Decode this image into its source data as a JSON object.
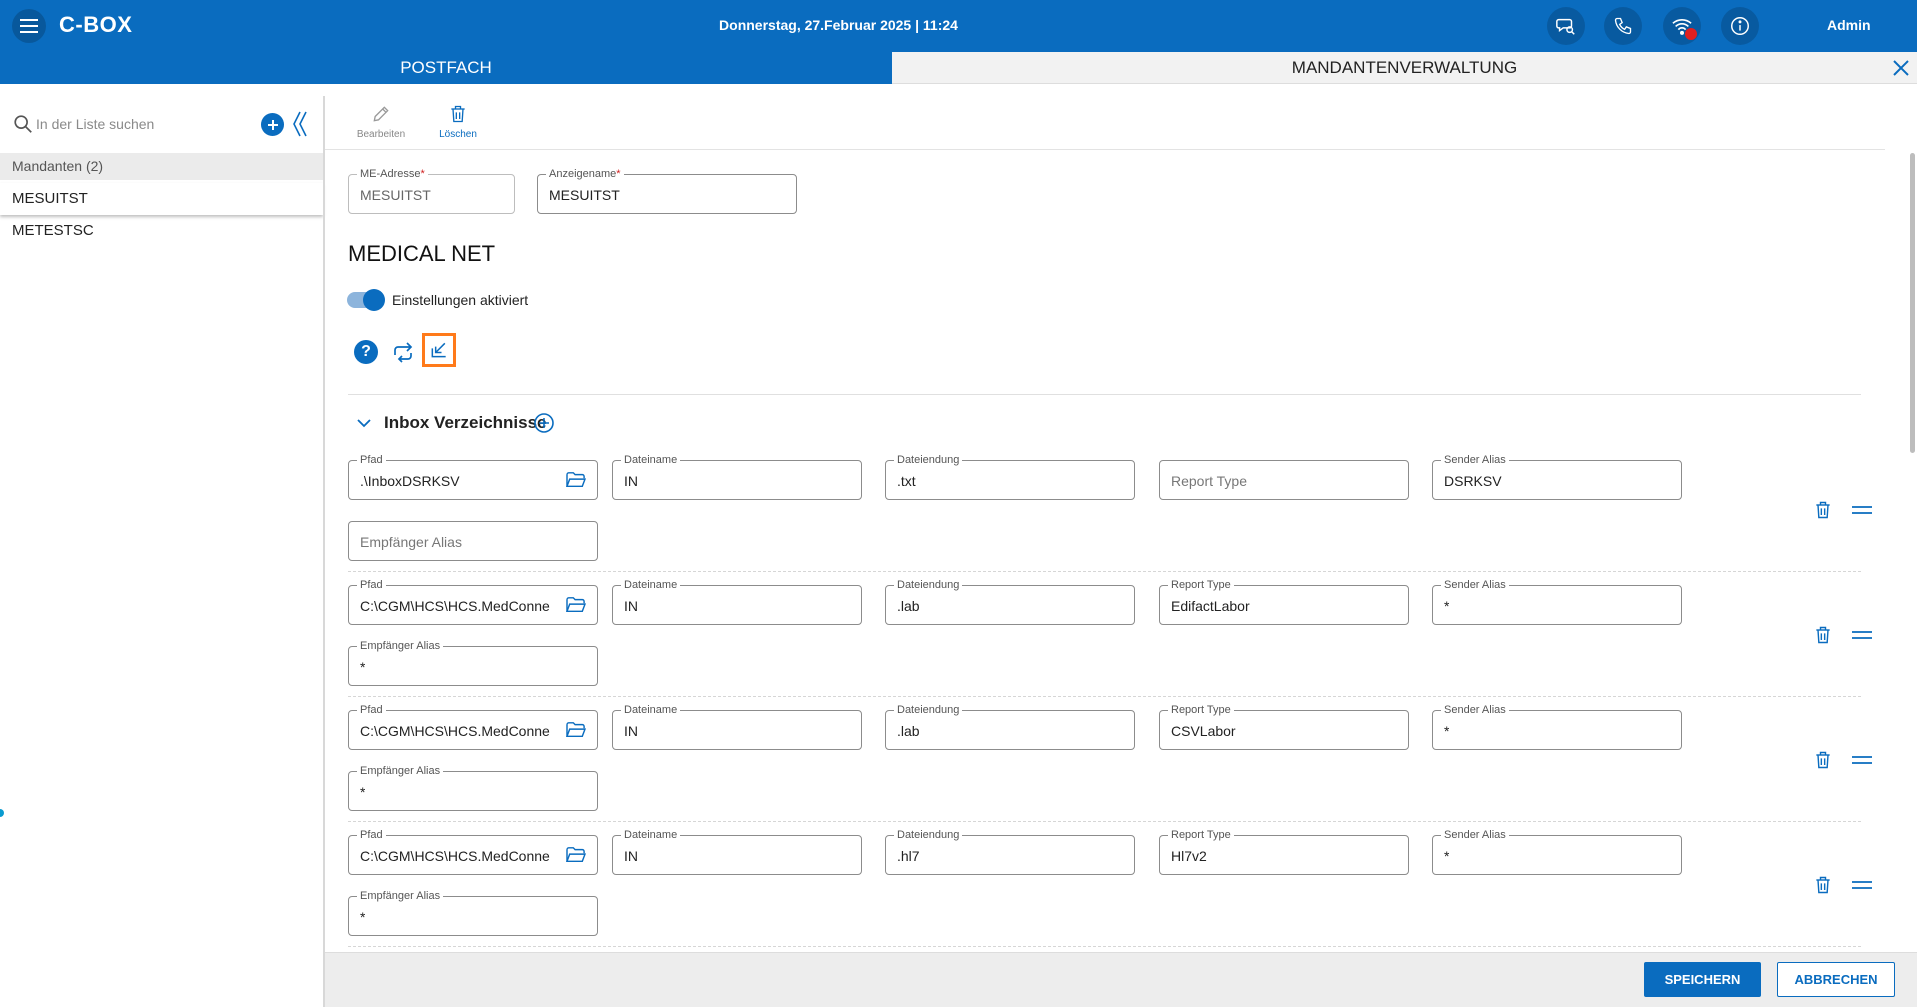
{
  "app": {
    "brand": "C-BOX",
    "datetime": "Donnerstag, 27.Februar 2025 | 11:24",
    "user": "Admin",
    "icons": [
      "menu-icon",
      "chat-search-icon",
      "phone-icon",
      "wifi-icon",
      "info-icon"
    ]
  },
  "tabs": {
    "left": "POSTFACH",
    "right": "MANDANTENVERWALTUNG"
  },
  "sidebar": {
    "search_placeholder": "In der Liste suchen",
    "group_header": "Mandanten (2)",
    "items": [
      {
        "label": "MESUITST",
        "selected": true
      },
      {
        "label": "METESTSC",
        "selected": false
      }
    ]
  },
  "toolbar": {
    "edit_label": "Bearbeiten",
    "delete_label": "Löschen"
  },
  "form": {
    "me_address": {
      "label": "ME-Adresse",
      "required_mark": "*",
      "value": "MESUITST"
    },
    "display_name": {
      "label": "Anzeigename",
      "required_mark": "*",
      "value": "MESUITST"
    }
  },
  "section": {
    "title": "MEDICAL NET",
    "toggle_label": "Einstellungen aktiviert",
    "toggle_on": true,
    "help_glyph": "?"
  },
  "inbox": {
    "title": "Inbox Verzeichnisse",
    "labels": {
      "path": "Pfad",
      "filename": "Dateiname",
      "extension": "Dateiendung",
      "report_type": "Report Type",
      "sender_alias": "Sender Alias",
      "recipient_alias": "Empfänger Alias"
    },
    "rows": [
      {
        "path": ".\\InboxDSRKSV",
        "filename": "IN",
        "extension": ".txt",
        "report_type": "",
        "sender_alias": "DSRKSV",
        "recipient_alias": ""
      },
      {
        "path": "C:\\CGM\\HCS\\HCS.MedConnect",
        "filename": "IN",
        "extension": ".lab",
        "report_type": "EdifactLabor",
        "sender_alias": "*",
        "recipient_alias": "*"
      },
      {
        "path": "C:\\CGM\\HCS\\HCS.MedConnect",
        "filename": "IN",
        "extension": ".lab",
        "report_type": "CSVLabor",
        "sender_alias": "*",
        "recipient_alias": "*"
      },
      {
        "path": "C:\\CGM\\HCS\\HCS.MedConnect",
        "filename": "IN",
        "extension": ".hl7",
        "report_type": "Hl7v2",
        "sender_alias": "*",
        "recipient_alias": "*"
      }
    ]
  },
  "footer": {
    "save_label": "SPEICHERN",
    "cancel_label": "ABBRECHEN"
  },
  "colors": {
    "primary": "#0a6cbf",
    "highlight": "#ff7a1a",
    "alert": "#e02020"
  }
}
